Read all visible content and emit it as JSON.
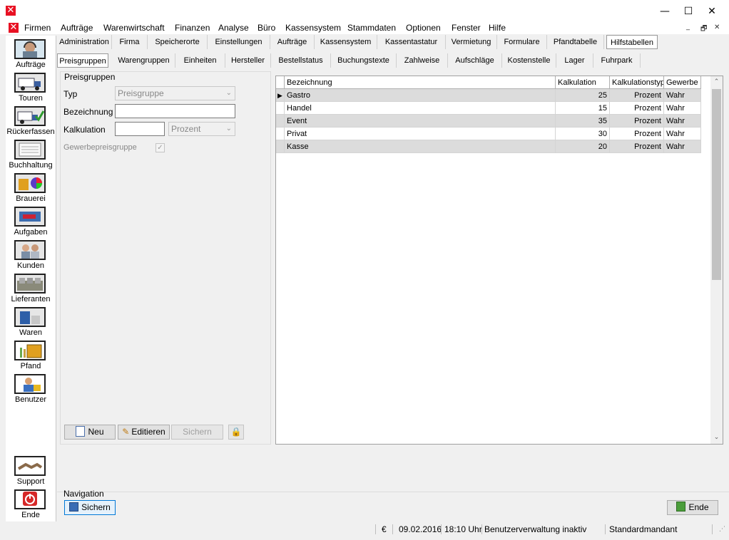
{
  "window": {
    "minimize": "—",
    "maximize": "☐",
    "close": "✕"
  },
  "menu": {
    "items": [
      "Firmen",
      "Aufträge",
      "Warenwirtschaft",
      "Finanzen",
      "Analyse",
      "Büro",
      "Kassensystem",
      "Stammdaten",
      "Optionen",
      "Fenster",
      "Hilfe"
    ],
    "mdi_min": "_",
    "mdi_restore": "🗗",
    "mdi_close": "✕"
  },
  "sidebar": {
    "items": [
      {
        "label": "Aufträge",
        "icon": "headset-operator-icon"
      },
      {
        "label": "Touren",
        "icon": "truck-icon"
      },
      {
        "label": "Rückerfassen",
        "icon": "truck-check-icon"
      },
      {
        "label": "Buchhaltung",
        "icon": "ledger-icon"
      },
      {
        "label": "Brauerei",
        "icon": "brewery-icon"
      },
      {
        "label": "Aufgaben",
        "icon": "tasks-icon"
      },
      {
        "label": "Kunden",
        "icon": "customers-icon"
      },
      {
        "label": "Lieferanten",
        "icon": "suppliers-icon"
      },
      {
        "label": "Waren",
        "icon": "goods-icon"
      },
      {
        "label": "Pfand",
        "icon": "deposit-crate-icon"
      },
      {
        "label": "Benutzer",
        "icon": "user-lock-icon"
      }
    ],
    "bottom": [
      {
        "label": "Support",
        "icon": "handshake-icon"
      },
      {
        "label": "Ende",
        "icon": "power-icon"
      }
    ]
  },
  "tabs_main": [
    "Administration",
    "Firma",
    "Speicherorte",
    "Einstellungen",
    "Aufträge",
    "Kassensystem",
    "Kassentastatur",
    "Vermietung",
    "Formulare",
    "Pfandtabelle",
    "Hilfstabellen"
  ],
  "tabs_main_active": "Hilfstabellen",
  "tabs_sub": [
    "Preisgruppen",
    "Warengruppen",
    "Einheiten",
    "Hersteller",
    "Bestellstatus",
    "Buchungstexte",
    "Zahlweise",
    "Aufschläge",
    "Kostenstelle",
    "Lager",
    "Fuhrpark"
  ],
  "tabs_sub_active": "Preisgruppen",
  "form": {
    "group_title": "Preisgruppen",
    "typ_label": "Typ",
    "typ_value": "Preisgruppe",
    "bezeichnung_label": "Bezeichnung",
    "bezeichnung_value": "",
    "kalkulation_label": "Kalkulation",
    "kalkulation_value": "",
    "kalkulationstyp_value": "Prozent",
    "gewerbe_label": "Gewerbepreisgruppe",
    "gewerbe_checked": true,
    "btn_neu": "Neu",
    "btn_editieren": "Editieren",
    "btn_sichern": "Sichern"
  },
  "grid": {
    "columns": [
      "Bezeichnung",
      "Kalkulation",
      "Kalkulationstyp",
      "Gewerbe"
    ],
    "rows": [
      [
        "Gastro",
        "25",
        "Prozent",
        "Wahr"
      ],
      [
        "Handel",
        "15",
        "Prozent",
        "Wahr"
      ],
      [
        "Event",
        "35",
        "Prozent",
        "Wahr"
      ],
      [
        "Privat",
        "30",
        "Prozent",
        "Wahr"
      ],
      [
        "Kasse",
        "20",
        "Prozent",
        "Wahr"
      ]
    ]
  },
  "navigation": {
    "label": "Navigation",
    "save": "Sichern",
    "end": "Ende"
  },
  "status": {
    "currency": "€",
    "date": "09.02.2016",
    "time": "18:10 Uhr",
    "user_admin": "Benutzerverwaltung inaktiv",
    "mandant": "Standardmandant"
  },
  "colors": {
    "accent": "#e81123",
    "row_alt": "#dcdcdc",
    "focus_border": "#0078d7"
  }
}
